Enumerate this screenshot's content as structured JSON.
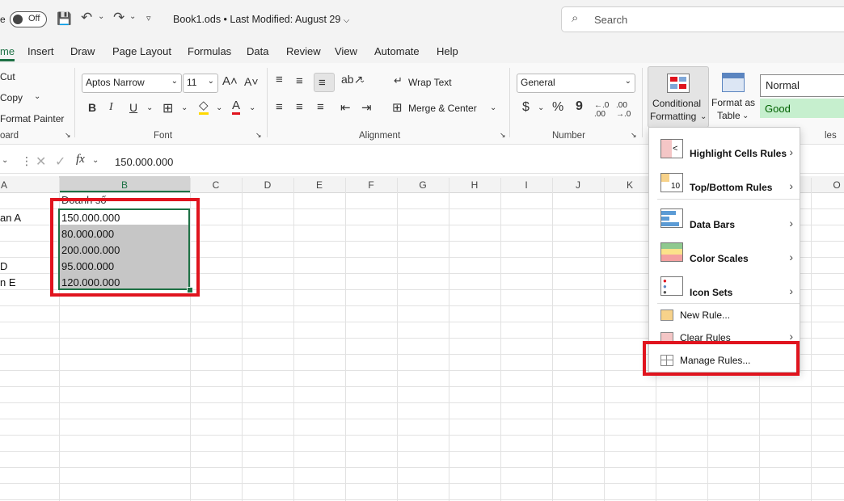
{
  "titlebar": {
    "autosave_partial": "e",
    "toggle_label": "Off",
    "document_title": "Book1.ods • Last Modified: August 29",
    "search_placeholder": "Search"
  },
  "menu": {
    "items": [
      {
        "label": "me",
        "active": true
      },
      {
        "label": "Insert"
      },
      {
        "label": "Draw"
      },
      {
        "label": "Page Layout"
      },
      {
        "label": "Formulas"
      },
      {
        "label": "Data"
      },
      {
        "label": "Review"
      },
      {
        "label": "View"
      },
      {
        "label": "Automate"
      },
      {
        "label": "Help"
      }
    ]
  },
  "ribbon": {
    "clipboard": {
      "cut": "Cut",
      "copy": "Copy",
      "format_painter": "Format Painter",
      "group_label": "oard"
    },
    "font": {
      "font_name": "Aptos Narrow",
      "font_size": "11",
      "bold": "B",
      "italic": "I",
      "underline": "U",
      "font_color_letter": "A",
      "group_label": "Font"
    },
    "alignment": {
      "wrap_text": "Wrap Text",
      "merge_center": "Merge & Center",
      "group_label": "Alignment"
    },
    "number": {
      "format": "General",
      "currency": "$",
      "percent": "%",
      "comma": "9",
      "group_label": "Number"
    },
    "styles": {
      "conditional_formatting_line1": "Conditional",
      "conditional_formatting_line2": "Formatting",
      "format_as_table_line1": "Format as",
      "format_as_table_line2": "Table",
      "normal": "Normal",
      "good": "Good",
      "group_label_partial": "les"
    }
  },
  "formula_bar": {
    "value": "150.000.000",
    "fx": "fx"
  },
  "grid": {
    "columns": [
      "A",
      "B",
      "C",
      "D",
      "E",
      "F",
      "G",
      "H",
      "I",
      "J",
      "K",
      "O"
    ],
    "col_a_cells": [
      "an A",
      "D",
      "n E"
    ],
    "header_cell_partial": "Doanh số",
    "values": [
      "150.000.000",
      "80.000.000",
      "200.000.000",
      "95.000.000",
      "120.000.000"
    ]
  },
  "cf_menu": {
    "items": [
      {
        "label": "Highlight Cells Rules",
        "has_submenu": true
      },
      {
        "label": "Top/Bottom Rules",
        "has_submenu": true
      },
      {
        "label": "Data Bars",
        "has_submenu": true
      },
      {
        "label": "Color Scales",
        "has_submenu": true
      },
      {
        "label": "Icon Sets",
        "has_submenu": true
      },
      {
        "label": "New Rule..."
      },
      {
        "label": "Clear Rules",
        "has_submenu": true
      },
      {
        "label": "Manage Rules..."
      }
    ],
    "top_bottom_icon_text": "10"
  },
  "colors": {
    "accent": "#1e7145",
    "highlight_red": "#e0141e",
    "good_fill": "#c6efce",
    "selection_fill": "#c6c6c6"
  }
}
